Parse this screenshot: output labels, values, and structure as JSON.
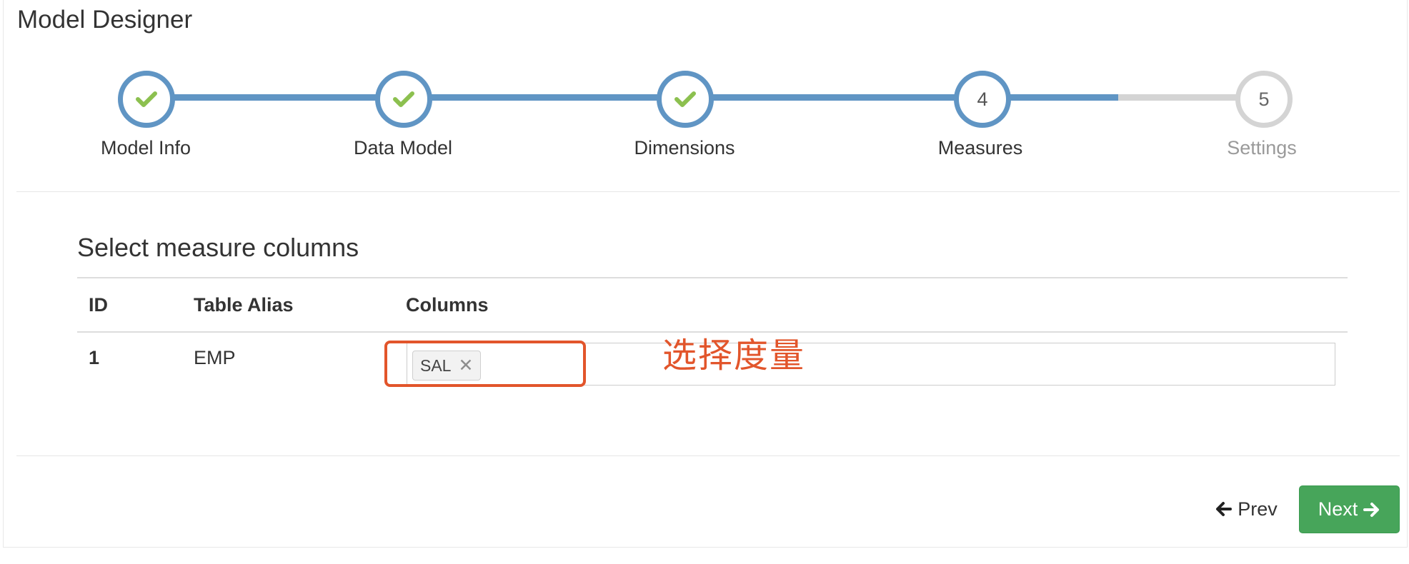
{
  "page": {
    "title": "Model Designer"
  },
  "steps": [
    {
      "label": "Model Info",
      "status": "complete",
      "number": "1"
    },
    {
      "label": "Data Model",
      "status": "complete",
      "number": "2"
    },
    {
      "label": "Dimensions",
      "status": "complete",
      "number": "3"
    },
    {
      "label": "Measures",
      "status": "current",
      "number": "4"
    },
    {
      "label": "Settings",
      "status": "todo",
      "number": "5"
    }
  ],
  "section": {
    "title": "Select measure columns"
  },
  "table": {
    "headers": [
      "ID",
      "Table Alias",
      "Columns"
    ],
    "rows": [
      {
        "id": "1",
        "alias": "EMP",
        "columns": [
          "SAL"
        ]
      }
    ]
  },
  "annotation": {
    "text": "选择度量"
  },
  "nav": {
    "prev_label": "Prev",
    "next_label": "Next"
  },
  "colors": {
    "step_active": "#6095c4",
    "step_inactive": "#d4d4d4",
    "check": "#8cc04f",
    "annotation": "#e2552b",
    "next_button": "#47a55a"
  }
}
